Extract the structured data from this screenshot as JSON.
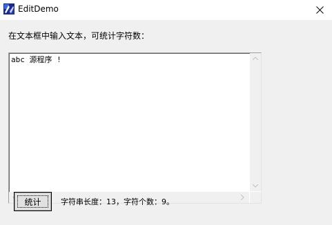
{
  "window": {
    "title": "EditDemo"
  },
  "icons": {
    "app": "app-icon",
    "close": "close-icon",
    "scroll_up": "chevron-up-icon",
    "scroll_down": "chevron-down-icon",
    "scroll_left": "chevron-left-icon",
    "scroll_right": "chevron-right-icon"
  },
  "main": {
    "prompt_label": "在文本框中输入文本，可统计字符数：",
    "edit_value": "abc 源程序 !",
    "count_button_label": "统计",
    "result_text": "字符串长度：13，字符个数：9。"
  },
  "colors": {
    "window_bg": "#f0f0f0",
    "titlebar_bg": "#ffffff",
    "edit_bg": "#ffffff"
  }
}
